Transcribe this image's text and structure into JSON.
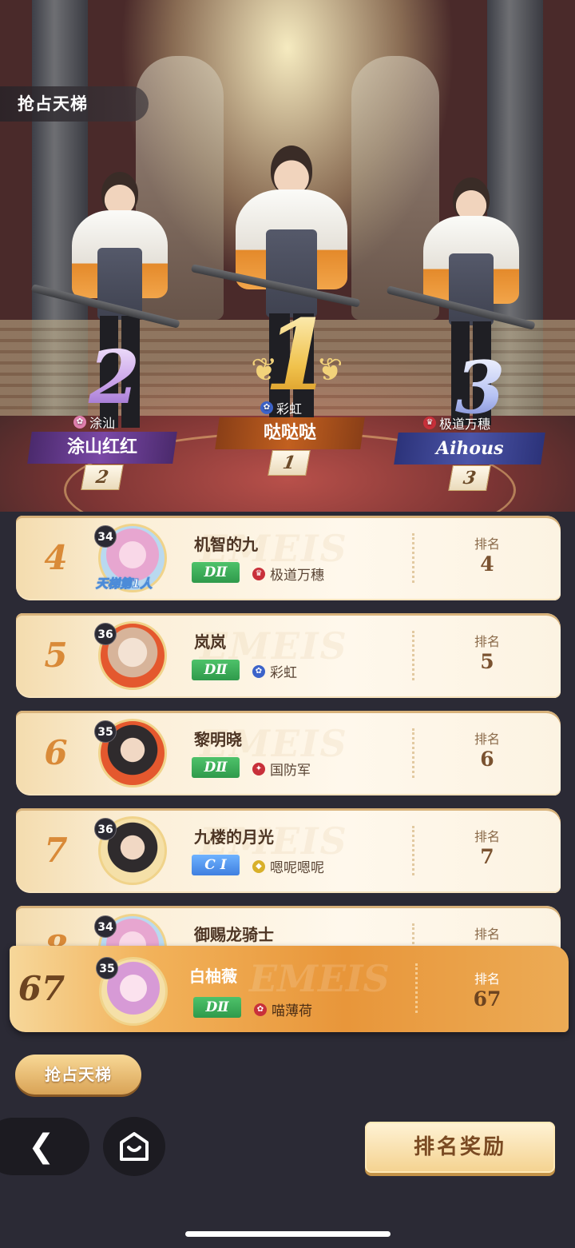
{
  "header": {
    "title": "抢占天梯"
  },
  "podium": [
    {
      "rank_big": "1",
      "guild": "彩虹",
      "guild_color": "#3c63c9",
      "name": "哒哒哒",
      "rank": "1"
    },
    {
      "rank_big": "2",
      "guild": "涂汕",
      "guild_color": "#e07fae",
      "name": "涂山红红",
      "rank": "2"
    },
    {
      "rank_big": "3",
      "guild": "极道万穗",
      "guild_color": "#c8303a",
      "name": "Aihous",
      "rank": "3"
    }
  ],
  "list": [
    {
      "pos": "4",
      "level": "34",
      "name": "机智的九",
      "tier": "DⅡ",
      "guild": "极道万穗",
      "rank_label": "排名",
      "rank": "4",
      "badge": "天梯第1人"
    },
    {
      "pos": "5",
      "level": "36",
      "name": "岚岚",
      "tier": "DⅡ",
      "guild": "彩虹",
      "rank_label": "排名",
      "rank": "5"
    },
    {
      "pos": "6",
      "level": "35",
      "name": "黎明晓",
      "tier": "DⅡ",
      "guild": "国防军",
      "rank_label": "排名",
      "rank": "6"
    },
    {
      "pos": "7",
      "level": "36",
      "name": "九楼的月光",
      "tier": "C Ⅰ",
      "guild": "嗯呢嗯呢",
      "rank_label": "排名",
      "rank": "7"
    },
    {
      "pos": "8",
      "level": "34",
      "name": "御赐龙骑士",
      "rank_label": "排名"
    }
  ],
  "self": {
    "pos": "67",
    "level": "35",
    "name": "白柚薇",
    "tier": "DⅡ",
    "guild": "喵薄荷",
    "rank_label": "排名",
    "rank": "67"
  },
  "buttons": {
    "ladder": "抢占天梯",
    "reward": "排名奖励"
  }
}
